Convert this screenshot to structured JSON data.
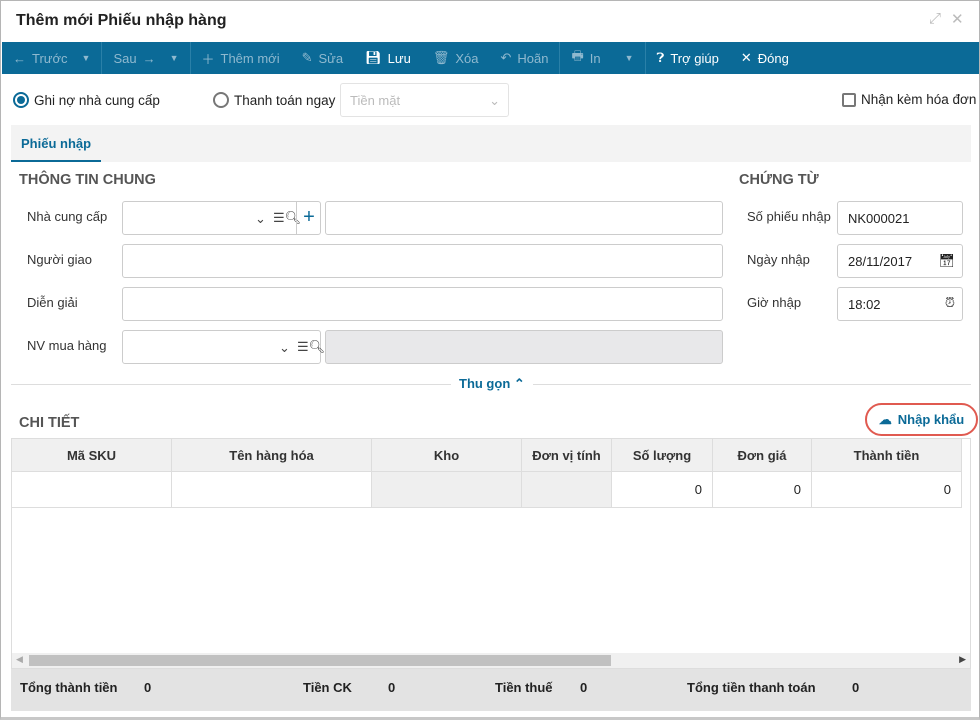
{
  "title": "Thêm mới Phiếu nhập hàng",
  "toolbar": {
    "prev": "Trước",
    "next": "Sau",
    "add": "Thêm mới",
    "edit": "Sửa",
    "save": "Lưu",
    "delete": "Xóa",
    "undo": "Hoãn",
    "print": "In",
    "help": "Trợ giúp",
    "close": "Đóng"
  },
  "payment": {
    "debt": "Ghi nợ nhà cung cấp",
    "pay_now": "Thanh toán ngay",
    "method_placeholder": "Tiền mặt",
    "invoice": "Nhận kèm hóa đơn"
  },
  "tab": "Phiếu nhập",
  "general": {
    "heading": "THÔNG TIN CHUNG",
    "supplier": "Nhà cung cấp",
    "deliverer": "Người giao",
    "description": "Diễn giải",
    "buyer": "NV mua hàng"
  },
  "voucher": {
    "heading": "CHỨNG TỪ",
    "number_label": "Số phiếu nhập",
    "number": "NK000021",
    "date_label": "Ngày nhập",
    "date": "28/11/2017",
    "time_label": "Giờ nhập",
    "time": "18:02"
  },
  "collapse": "Thu gọn",
  "detail": {
    "heading": "CHI TIẾT",
    "import": "Nhập khẩu",
    "columns": [
      "Mã SKU",
      "Tên hàng hóa",
      "Kho",
      "Đơn vị tính",
      "Số lượng",
      "Đơn giá",
      "Thành tiền"
    ],
    "row": [
      "",
      "",
      "",
      "",
      "0",
      "0",
      "0"
    ]
  },
  "totals": {
    "total_label": "Tổng thành tiền",
    "total": "0",
    "discount_label": "Tiền CK",
    "discount": "0",
    "tax_label": "Tiền thuế",
    "tax": "0",
    "pay_label": "Tổng tiền thanh toán",
    "pay": "0"
  }
}
